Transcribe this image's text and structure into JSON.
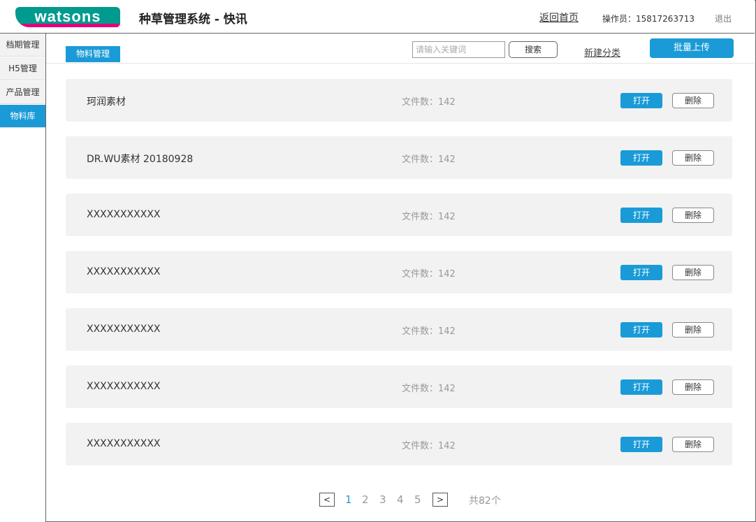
{
  "header": {
    "logo_text": "watsons",
    "title": "种草管理系统 - 快讯",
    "back_home": "返回首页",
    "operator": "操作员：15817263713",
    "logout": "退出"
  },
  "sidebar": {
    "items": [
      {
        "label": "档期管理"
      },
      {
        "label": "H5管理"
      },
      {
        "label": "产品管理"
      },
      {
        "label": "物料库",
        "active": true
      }
    ]
  },
  "toolbar": {
    "tab_label": "物料管理",
    "search_placeholder": "请输入关键词",
    "search_label": "搜索",
    "new_category": "新建分类",
    "bulk_upload": "批量上传"
  },
  "folders": [
    {
      "name": "珂润素材",
      "count": "文件数：142"
    },
    {
      "name": "DR.WU素材 20180928",
      "count": "文件数：142"
    },
    {
      "name": "XXXXXXXXXXX",
      "count": "文件数：142"
    },
    {
      "name": "XXXXXXXXXXX",
      "count": "文件数：142"
    },
    {
      "name": "XXXXXXXXXXX",
      "count": "文件数：142"
    },
    {
      "name": "XXXXXXXXXXX",
      "count": "文件数：142"
    },
    {
      "name": "XXXXXXXXXXX",
      "count": "文件数：142"
    }
  ],
  "row_actions": {
    "open": "打开",
    "delete": "删除"
  },
  "pagination": {
    "prev": "<",
    "next": ">",
    "pages": [
      "1",
      "2",
      "3",
      "4",
      "5"
    ],
    "current": "1",
    "total": "共82个"
  },
  "colors": {
    "accent": "#1a9bd7",
    "brand_green": "#009a8e",
    "brand_pink": "#e4007f"
  }
}
